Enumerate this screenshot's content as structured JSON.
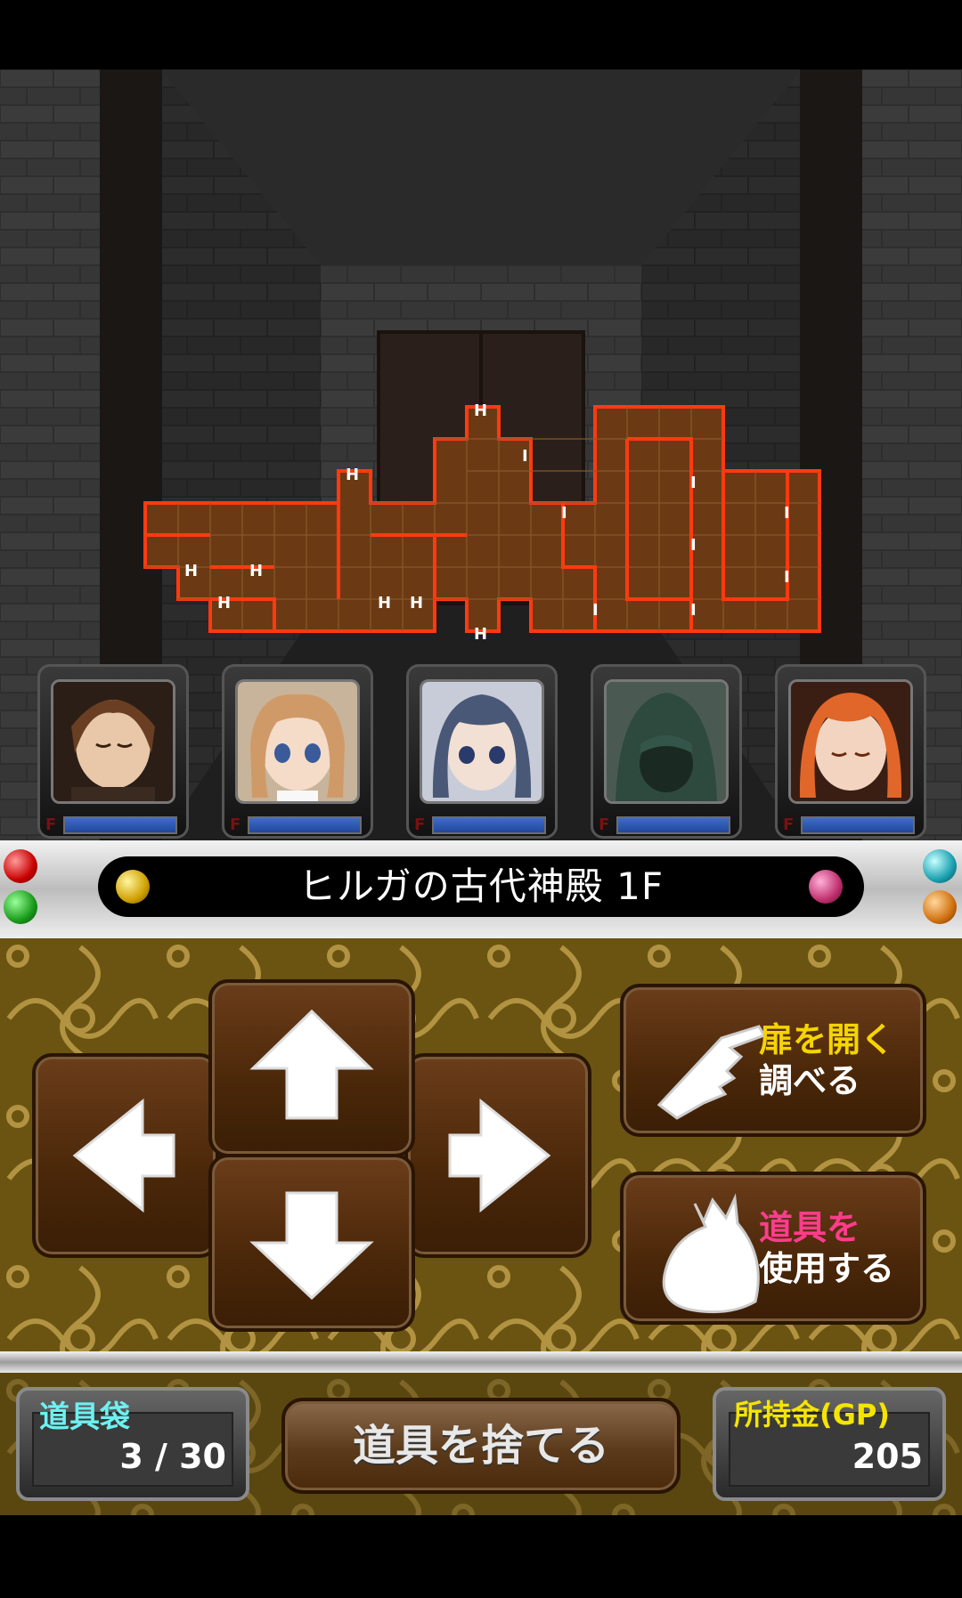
{
  "location": {
    "name": "ヒルガの古代神殿  1F"
  },
  "party": [
    {
      "name": "member-1",
      "hp_fraction": 1.0,
      "status": "F"
    },
    {
      "name": "member-2",
      "hp_fraction": 1.0,
      "status": "F"
    },
    {
      "name": "member-3",
      "hp_fraction": 1.0,
      "status": "F"
    },
    {
      "name": "member-4",
      "hp_fraction": 1.0,
      "status": "F"
    },
    {
      "name": "member-5",
      "hp_fraction": 1.0,
      "status": "F"
    }
  ],
  "controls": {
    "open_door": {
      "line1": "扉を開く",
      "line2": "調べる"
    },
    "use_item": {
      "line1": "道具を",
      "line2": "使用する"
    },
    "discard_item": "道具を捨てる"
  },
  "inventory": {
    "label": "道具袋",
    "value": "3 / 30"
  },
  "gold": {
    "label": "所持金(GP)",
    "value": "205"
  },
  "colors": {
    "accent_yellow": "#f5d400",
    "accent_pink": "#ff3c8c",
    "map_line": "#ff3a10",
    "map_fill": "#6b3a14"
  }
}
